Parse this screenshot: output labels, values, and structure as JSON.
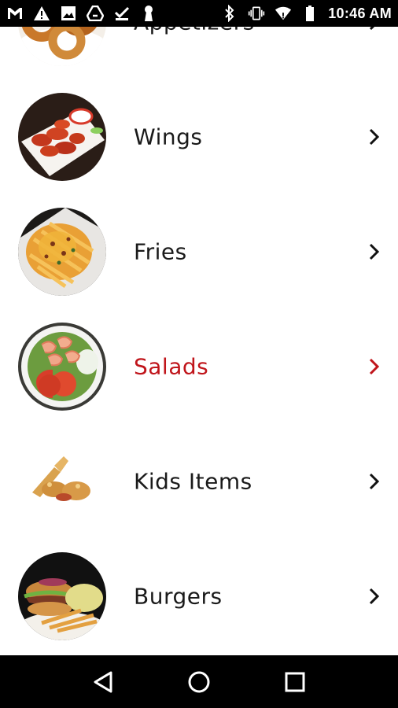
{
  "status_bar": {
    "time": "10:46 AM",
    "left_icons": [
      "gmail-icon",
      "warning-icon",
      "image-icon",
      "drive-icon",
      "download-done-icon",
      "keyhole-icon"
    ],
    "right_icons": [
      "bluetooth-icon",
      "vibrate-icon",
      "wifi-icon",
      "battery-icon"
    ]
  },
  "menu": {
    "accent_color": "#c0151b",
    "items": [
      {
        "label": "Appetizers",
        "image": "onion-rings-photo",
        "active": false
      },
      {
        "label": "Wings",
        "image": "buffalo-wings-photo",
        "active": false
      },
      {
        "label": "Fries",
        "image": "cheese-fries-photo",
        "active": false
      },
      {
        "label": "Salads",
        "image": "shrimp-salad-photo",
        "active": true
      },
      {
        "label": "Kids Items",
        "image": "chicken-tenders-photo",
        "active": false
      },
      {
        "label": "Burgers",
        "image": "burger-photo",
        "active": false
      }
    ]
  },
  "nav_bar": {
    "buttons": [
      "back-icon",
      "home-icon",
      "recents-icon"
    ]
  }
}
